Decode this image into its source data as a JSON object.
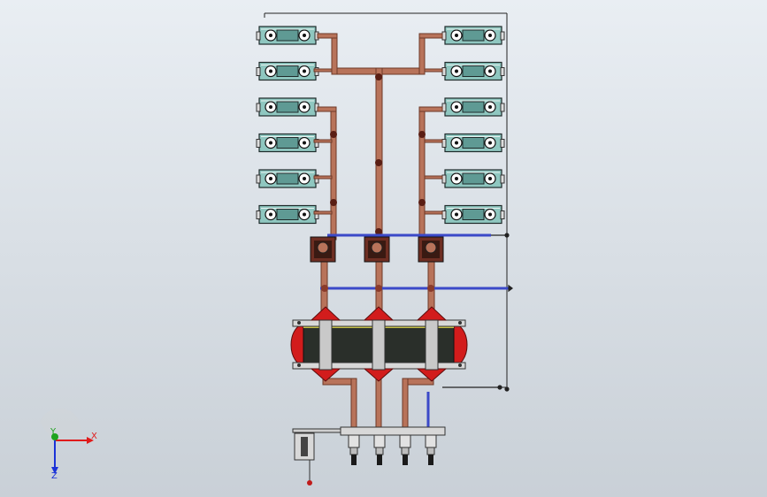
{
  "view": {
    "background_top": "#e9eef3",
    "background_bottom": "#c9d0d7"
  },
  "colors": {
    "copper_busbar": "#b8735a",
    "copper_edge": "#6e3a28",
    "cable_blue": "#3b49c8",
    "breaker_body": "#8fc7c0",
    "breaker_edge": "#1e2a2a",
    "insulator_red": "#d21c1c",
    "tank_dark": "#2a2f2a",
    "frame_grey": "#c9c9c9"
  },
  "triad": {
    "x_label": "X",
    "y_label": "Y",
    "z_label": "Z",
    "x_color": "#e01b1b",
    "y_color": "#1fa31f",
    "z_color": "#1b33d8"
  },
  "components": {
    "breaker_rows": 6,
    "breaker_columns": 2,
    "bushings": 3,
    "cable_terminals": 4
  }
}
